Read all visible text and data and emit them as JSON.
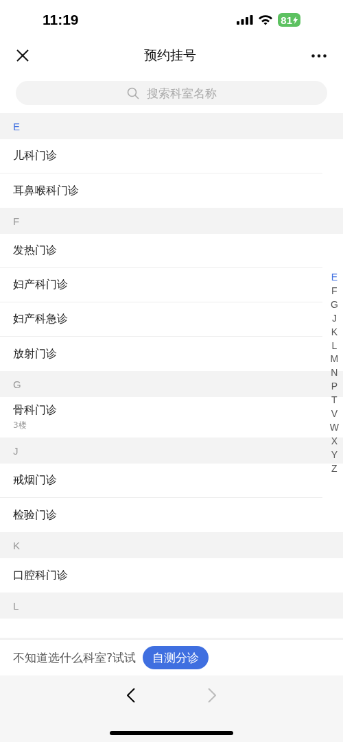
{
  "status_bar": {
    "time": "11:19",
    "battery": "81"
  },
  "nav": {
    "title": "预约挂号"
  },
  "search": {
    "placeholder": "搜索科室名称"
  },
  "sections": [
    {
      "letter": "E",
      "selected": true,
      "items": [
        {
          "name": "儿科门诊"
        },
        {
          "name": "耳鼻喉科门诊"
        }
      ]
    },
    {
      "letter": "F",
      "selected": false,
      "items": [
        {
          "name": "发热门诊"
        },
        {
          "name": "妇产科门诊"
        },
        {
          "name": "妇产科急诊"
        },
        {
          "name": "放射门诊"
        }
      ]
    },
    {
      "letter": "G",
      "selected": false,
      "items": [
        {
          "name": "骨科门诊",
          "note": "3楼"
        }
      ]
    },
    {
      "letter": "J",
      "selected": false,
      "items": [
        {
          "name": "戒烟门诊"
        },
        {
          "name": "检验门诊"
        }
      ]
    },
    {
      "letter": "K",
      "selected": false,
      "items": [
        {
          "name": "口腔科门诊"
        }
      ]
    },
    {
      "letter": "L",
      "selected": false
    }
  ],
  "index": [
    {
      "letter": "E",
      "selected": true
    },
    {
      "letter": "F",
      "selected": false
    },
    {
      "letter": "G",
      "selected": false
    },
    {
      "letter": "J",
      "selected": false
    },
    {
      "letter": "K",
      "selected": false
    },
    {
      "letter": "L",
      "selected": false
    },
    {
      "letter": "M",
      "selected": false
    },
    {
      "letter": "N",
      "selected": false
    },
    {
      "letter": "P",
      "selected": false
    },
    {
      "letter": "T",
      "selected": false
    },
    {
      "letter": "V",
      "selected": false
    },
    {
      "letter": "W",
      "selected": false
    },
    {
      "letter": "X",
      "selected": false
    },
    {
      "letter": "Y",
      "selected": false
    },
    {
      "letter": "Z",
      "selected": false
    }
  ],
  "footer": {
    "prompt": "不知道选什么科室?试试",
    "button": "自测分诊"
  },
  "browser_nav": {
    "back_disabled": false,
    "forward_disabled": true
  }
}
